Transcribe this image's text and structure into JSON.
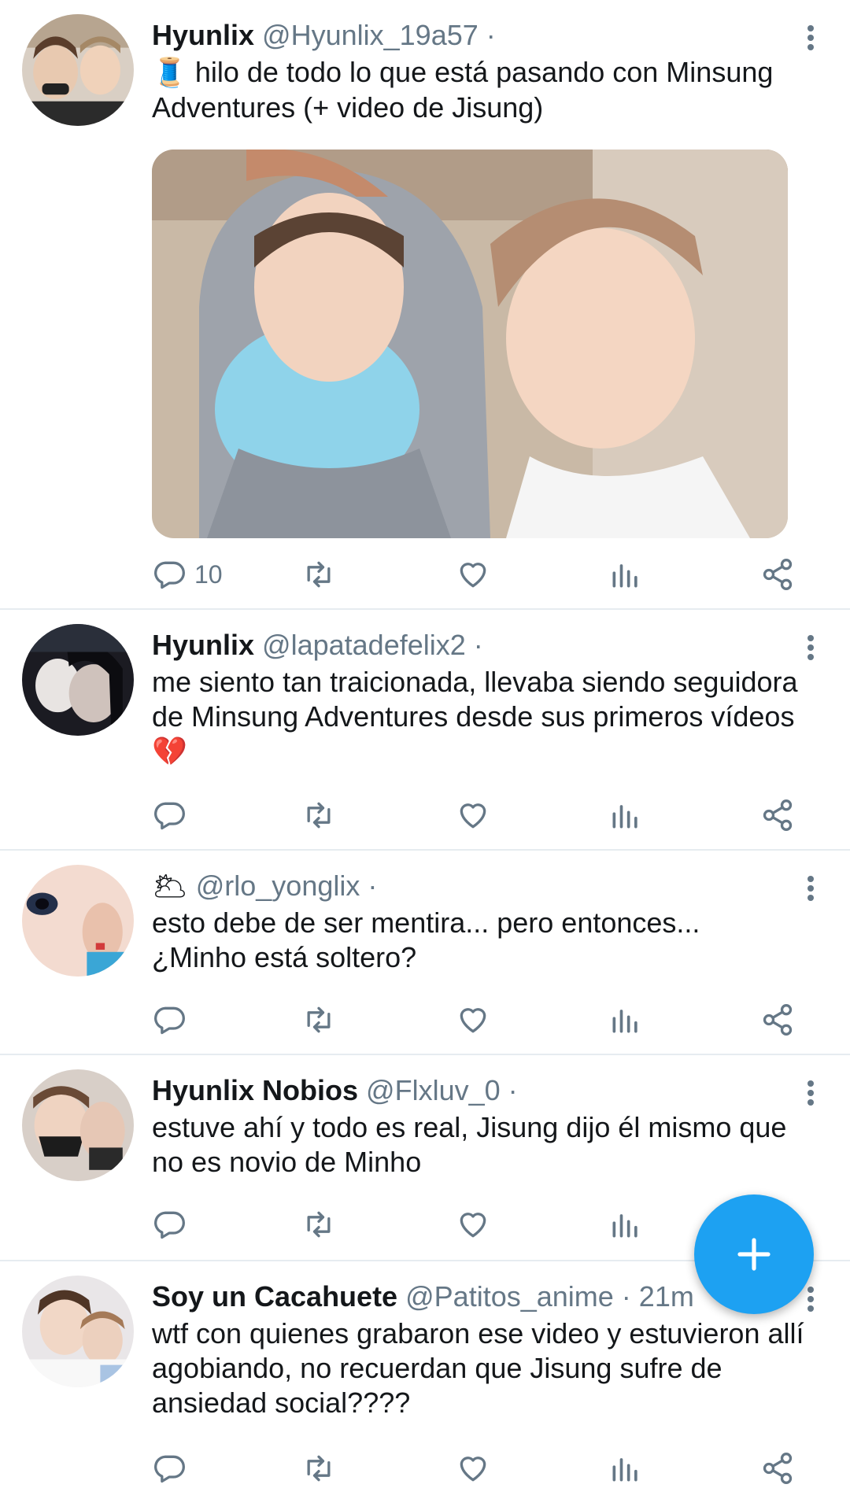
{
  "colors": {
    "accent": "#1da1f2",
    "secondary_text": "#657786",
    "divider": "#e6ecf0"
  },
  "tweets": [
    {
      "name": "Hyunlix",
      "handle": "@Hyunlix_19a57 ·",
      "time": "",
      "emoji": "🧵",
      "text": "hilo de todo lo que está pasando con Minsung Adventures (+ video de Jisung)",
      "reply_count": "10",
      "has_media": true
    },
    {
      "name": "Hyunlix",
      "handle": "@lapatadefelix2 ·",
      "time": "",
      "text": "me siento tan traicionada, llevaba siendo seguidora de Minsung Adventures desde sus primeros vídeos",
      "text_emoji": "💔",
      "reply_count": ""
    },
    {
      "name": "",
      "name_emoji": "🌥",
      "handle": "@rlo_yonglix ·",
      "time": "",
      "text_line1": "esto debe de ser mentira... pero entonces...",
      "text_line2": "¿Minho está soltero?",
      "reply_count": ""
    },
    {
      "name": "Hyunlix Nobios",
      "handle": "@Flxluv_0 ·",
      "time": "",
      "text": "estuve ahí y todo es real, Jisung dijo él mismo que no es novio de Minho",
      "reply_count": ""
    },
    {
      "name": "Soy un Cacahuete",
      "handle": "@Patitos_anime ·",
      "time": "21m",
      "text": "wtf con quienes grabaron ese video y estuvieron allí agobiando, no recuerdan que Jisung sufre de ansiedad social????",
      "reply_count": ""
    }
  ],
  "icons": {
    "reply": "reply-icon",
    "retweet": "retweet-icon",
    "like": "heart-icon",
    "analytics": "analytics-icon",
    "share": "share-icon",
    "more": "more-vertical-icon",
    "compose": "plus-icon"
  }
}
